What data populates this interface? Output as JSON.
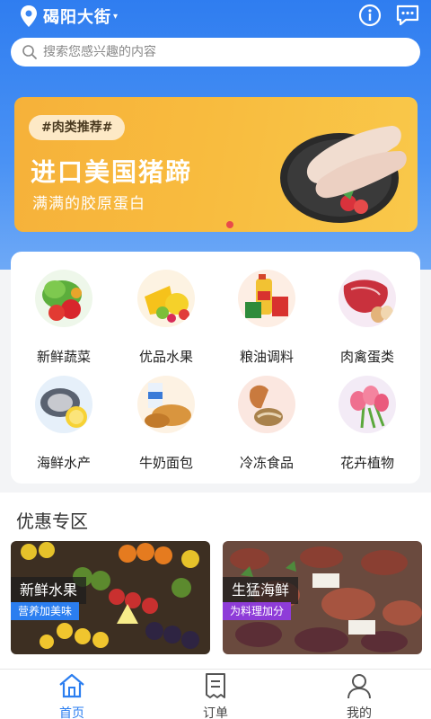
{
  "header": {
    "location": "碣阳大街",
    "caret": "▾",
    "info_icon": "info-icon",
    "message_icon": "message-icon"
  },
  "search": {
    "placeholder": "搜索您感兴趣的内容"
  },
  "banner": {
    "tag": "#肉类推荐#",
    "title": "进口美国猪蹄",
    "subtitle": "满满的胶原蛋白"
  },
  "categories": [
    {
      "label": "新鲜蔬菜",
      "icon": "vegetables-icon"
    },
    {
      "label": "优品水果",
      "icon": "fruit-icon"
    },
    {
      "label": "粮油调料",
      "icon": "grain-oil-icon"
    },
    {
      "label": "肉禽蛋类",
      "icon": "meat-egg-icon"
    },
    {
      "label": "海鲜水产",
      "icon": "seafood-icon"
    },
    {
      "label": "牛奶面包",
      "icon": "milk-bread-icon"
    },
    {
      "label": "冷冻食品",
      "icon": "frozen-food-icon"
    },
    {
      "label": "花卉植物",
      "icon": "flower-icon"
    }
  ],
  "promo": {
    "title": "优惠专区",
    "cards": [
      {
        "title": "新鲜水果",
        "subtitle": "营养加美味"
      },
      {
        "title": "生猛海鲜",
        "subtitle": "为料理加分"
      }
    ]
  },
  "tabs": [
    {
      "label": "首页",
      "icon": "home-icon",
      "active": true
    },
    {
      "label": "订单",
      "icon": "order-icon",
      "active": false
    },
    {
      "label": "我的",
      "icon": "profile-icon",
      "active": false
    }
  ],
  "colors": {
    "primary": "#2b7ef0",
    "banner": "#f8bb3e",
    "accent_red": "#e94a4a",
    "promo_purple": "#8e3cd8"
  }
}
